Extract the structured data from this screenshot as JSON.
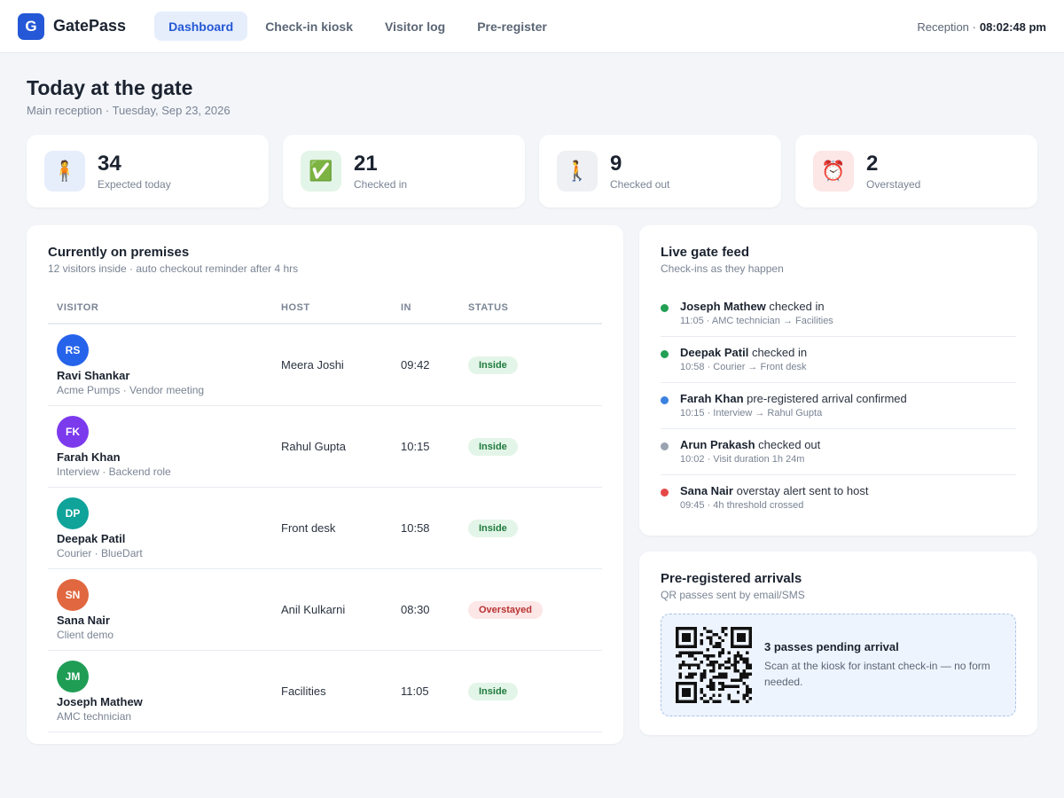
{
  "app": {
    "logo_letter": "G",
    "name": "GatePass"
  },
  "nav": [
    {
      "label": "Dashboard",
      "active": true
    },
    {
      "label": "Check-in kiosk",
      "active": false
    },
    {
      "label": "Visitor log",
      "active": false
    },
    {
      "label": "Pre-register",
      "active": false
    }
  ],
  "topbar": {
    "location": "Reception ·",
    "clock": "08:02:48 pm"
  },
  "page": {
    "title": "Today at the gate",
    "subtitle": "Main reception · Tuesday, Sep 23, 2026"
  },
  "stats": [
    {
      "value": "34",
      "label": "Expected today",
      "icon": "🧍",
      "icon_name": "person-standing-icon",
      "tint": "#e6eefc"
    },
    {
      "value": "21",
      "label": "Checked in",
      "icon": "✅",
      "icon_name": "check-icon",
      "tint": "#e3f5e8"
    },
    {
      "value": "9",
      "label": "Checked out",
      "icon": "🚶",
      "icon_name": "person-walking-icon",
      "tint": "#eef0f3"
    },
    {
      "value": "2",
      "label": "Overstayed",
      "icon": "⏰",
      "icon_name": "alarm-clock-icon",
      "tint": "#fde6e6"
    }
  ],
  "premises": {
    "title": "Currently on premises",
    "subtitle": "12 visitors inside · auto checkout reminder after 4 hrs",
    "columns": {
      "visitor": "VISITOR",
      "host": "HOST",
      "in": "IN",
      "status": "STATUS"
    },
    "rows": [
      {
        "initials": "RS",
        "color": "#2563eb",
        "name": "Ravi Shankar",
        "meta": "Acme Pumps · Vendor meeting",
        "host": "Meera Joshi",
        "in": "09:42",
        "status": "Inside",
        "status_kind": "inside"
      },
      {
        "initials": "FK",
        "color": "#7c3aed",
        "name": "Farah Khan",
        "meta": "Interview · Backend role",
        "host": "Rahul Gupta",
        "in": "10:15",
        "status": "Inside",
        "status_kind": "inside"
      },
      {
        "initials": "DP",
        "color": "#0fa39a",
        "name": "Deepak Patil",
        "meta": "Courier · BlueDart",
        "host": "Front desk",
        "in": "10:58",
        "status": "Inside",
        "status_kind": "inside"
      },
      {
        "initials": "SN",
        "color": "#e0673f",
        "name": "Sana Nair",
        "meta": "Client demo",
        "host": "Anil Kulkarni",
        "in": "08:30",
        "status": "Overstayed",
        "status_kind": "overstayed"
      },
      {
        "initials": "JM",
        "color": "#1f9d55",
        "name": "Joseph Mathew",
        "meta": "AMC technician",
        "host": "Facilities",
        "in": "11:05",
        "status": "Inside",
        "status_kind": "inside"
      }
    ]
  },
  "feed": {
    "title": "Live gate feed",
    "subtitle": "Check-ins as they happen",
    "items": [
      {
        "name": "Joseph Mathew",
        "action": " checked in",
        "meta": "11:05 · AMC technician → Facilities",
        "dot": "#22a055"
      },
      {
        "name": "Deepak Patil",
        "action": " checked in",
        "meta": "10:58 · Courier → Front desk",
        "dot": "#22a055"
      },
      {
        "name": "Farah Khan",
        "action": " pre-registered arrival confirmed",
        "meta": "10:15 · Interview → Rahul Gupta",
        "dot": "#3b82e0"
      },
      {
        "name": "Arun Prakash",
        "action": " checked out",
        "meta": "10:02 · Visit duration 1h 24m",
        "dot": "#9aa3b0"
      },
      {
        "name": "Sana Nair",
        "action": " overstay alert sent to host",
        "meta": "09:45 · 4h threshold crossed",
        "dot": "#e54848"
      }
    ]
  },
  "prereg": {
    "title": "Pre-registered arrivals",
    "subtitle": "QR passes sent by email/SMS",
    "pending": "3 passes pending arrival",
    "desc": "Scan at the kiosk for instant check-in — no form needed."
  }
}
